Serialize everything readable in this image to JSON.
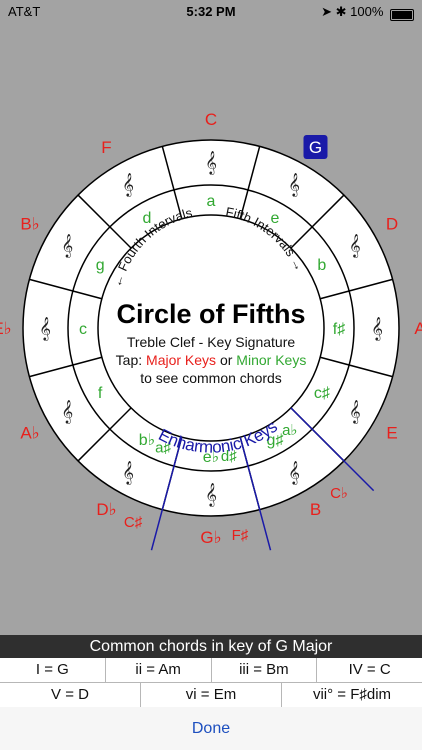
{
  "status": {
    "carrier": "AT&T",
    "time": "5:32 PM",
    "battery": "100%"
  },
  "title": "Circle of Fifths",
  "subtitle": "Treble Clef - Key Signature",
  "instruction": {
    "prefix": "Tap: ",
    "major": "Major Keys",
    "or": " or ",
    "minor": "Minor Keys",
    "line2": "to see common chords"
  },
  "arc_labels": {
    "fourth": "← Fourth Intervals",
    "fifth": "Fifth Intervals →",
    "enharmonic": "Enharmonic Keys"
  },
  "major_keys": [
    "C",
    "G",
    "D",
    "A",
    "E",
    "B",
    "G♭",
    "D♭",
    "A♭",
    "E♭",
    "B♭",
    "F"
  ],
  "minor_keys": [
    "a",
    "e",
    "b",
    "f♯",
    "c♯",
    "g♯",
    "e♭",
    "b♭",
    "f",
    "c",
    "g",
    "d"
  ],
  "enharmonic_major": [
    "C♭",
    "F♯",
    "C♯"
  ],
  "enharmonic_minor": [
    "a♭",
    "d♯",
    "a♯"
  ],
  "selected_key": "G",
  "colors": {
    "major": "#e8201c",
    "minor": "#32a832",
    "accent": "#1a1aa8"
  },
  "chords": {
    "header": "Common chords in key of G Major",
    "row1": [
      "I = G",
      "ii = Am",
      "iii = Bm",
      "IV = C"
    ],
    "row2": [
      "V = D",
      "vi = Em",
      "vii° = F♯dim"
    ]
  },
  "done_label": "Done"
}
